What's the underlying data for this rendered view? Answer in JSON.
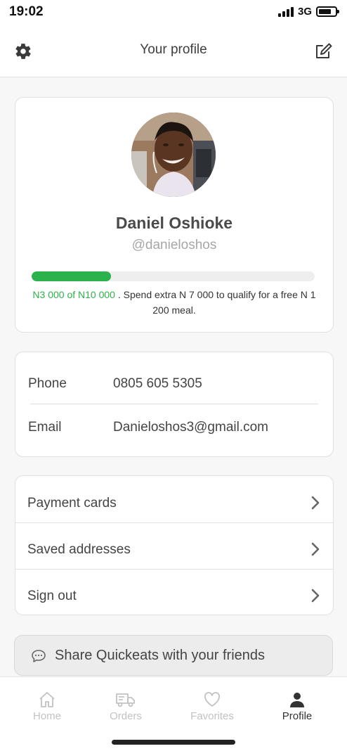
{
  "status_bar": {
    "time": "19:02",
    "network": "3G"
  },
  "header": {
    "title": "Your profile"
  },
  "profile": {
    "name": "Daniel Oshioke",
    "handle": "@danieloshos",
    "progress_fraction": 0.28,
    "progress_amount": "N3 000 of N10 000",
    "progress_message": " .  Spend extra N 7 000 to qualify for a free N 1 200 meal."
  },
  "contact": {
    "phone_label": "Phone",
    "phone_value": "0805 605 5305",
    "email_label": "Email",
    "email_value": "Danieloshos3@gmail.com"
  },
  "menu": {
    "items": [
      {
        "label": "Payment cards"
      },
      {
        "label": "Saved addresses"
      },
      {
        "label": "Sign out"
      }
    ]
  },
  "share": {
    "label": "Share Quickeats with your friends"
  },
  "tabbar": {
    "tabs": [
      {
        "label": "Home",
        "icon": "home-icon"
      },
      {
        "label": "Orders",
        "icon": "truck-icon"
      },
      {
        "label": "Favorites",
        "icon": "heart-icon"
      },
      {
        "label": "Profile",
        "icon": "user-icon"
      }
    ],
    "active": "Profile"
  },
  "colors": {
    "accent_green": "#2bb24c",
    "inactive_tab": "#c2c2c2"
  }
}
